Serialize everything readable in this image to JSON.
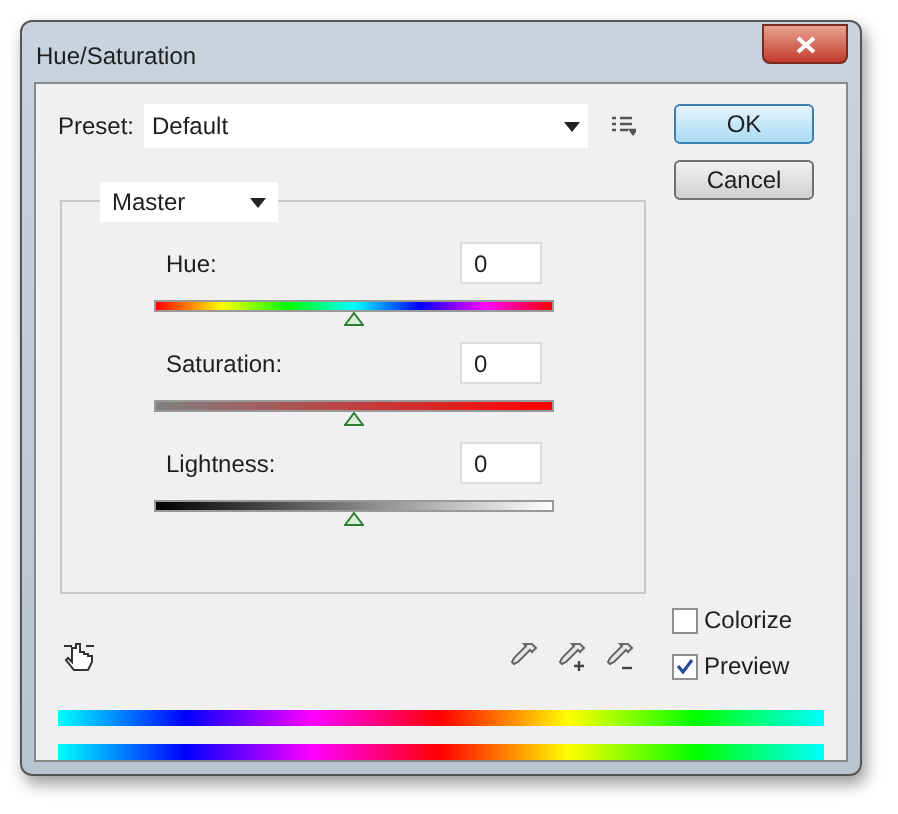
{
  "window": {
    "title": "Hue/Saturation"
  },
  "preset": {
    "label": "Preset:",
    "value": "Default"
  },
  "buttons": [
    {
      "label": "OK",
      "default": true
    },
    {
      "label": "Cancel",
      "default": false
    }
  ],
  "channel": {
    "value": "Master"
  },
  "sliders": [
    {
      "kind": "hue",
      "label": "Hue:",
      "value": "0",
      "level": 0.5
    },
    {
      "kind": "saturation",
      "label": "Saturation:",
      "value": "0",
      "level": 0.5
    },
    {
      "kind": "lightness",
      "label": "Lightness:",
      "value": "0",
      "level": 0.5
    }
  ],
  "options": [
    {
      "label": "Colorize",
      "checked": false
    },
    {
      "label": "Preview",
      "checked": true
    }
  ]
}
